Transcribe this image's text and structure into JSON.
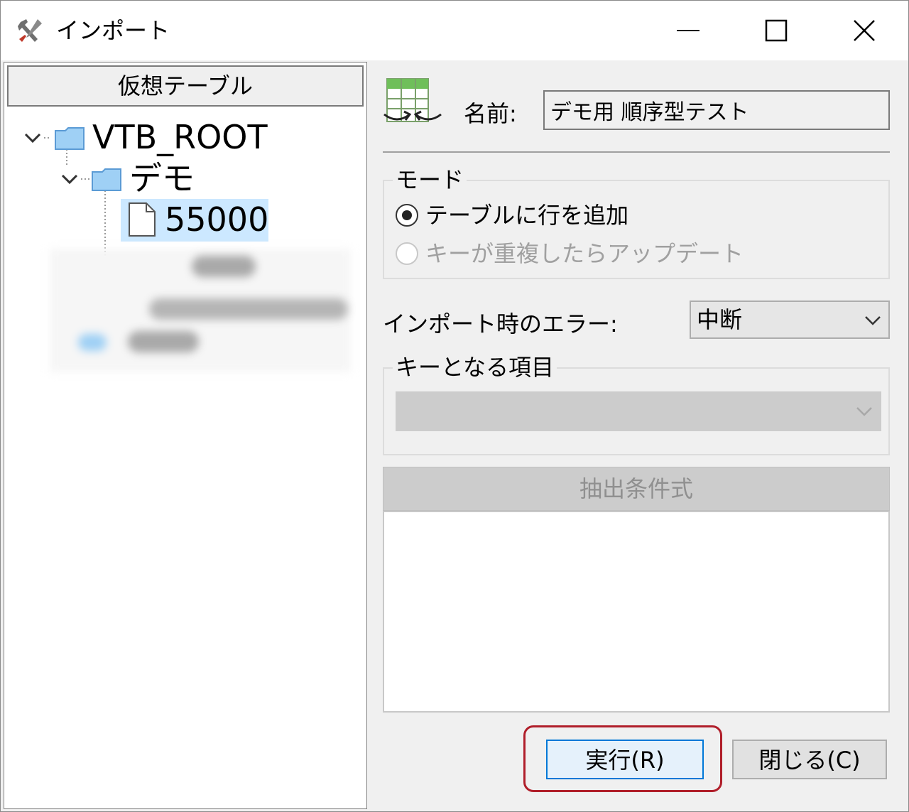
{
  "window": {
    "title": "インポート"
  },
  "left_panel": {
    "header": "仮想テーブル",
    "tree": {
      "root": {
        "label": "VTB_ROOT"
      },
      "folder": {
        "label": "デモ"
      },
      "item": {
        "label": "55000"
      }
    }
  },
  "form": {
    "name_label": "名前:",
    "name_value": "デモ用 順序型テスト",
    "mode": {
      "label": "モード",
      "options": [
        {
          "label": "テーブルに行を追加",
          "checked": true,
          "enabled": true
        },
        {
          "label": "キーが重複したらアップデート",
          "checked": false,
          "enabled": false
        }
      ]
    },
    "error": {
      "label": "インポート時のエラー:",
      "selected": "中断"
    },
    "key_item": {
      "label": "キーとなる項目",
      "selected": ""
    },
    "filter": {
      "button_label": "抽出条件式",
      "value": ""
    }
  },
  "buttons": {
    "run": "実行(R)",
    "close": "閉じる(C)"
  },
  "colors": {
    "selection": "#cce8ff",
    "highlight": "#b01e2a",
    "primary_border": "#0078d7"
  }
}
